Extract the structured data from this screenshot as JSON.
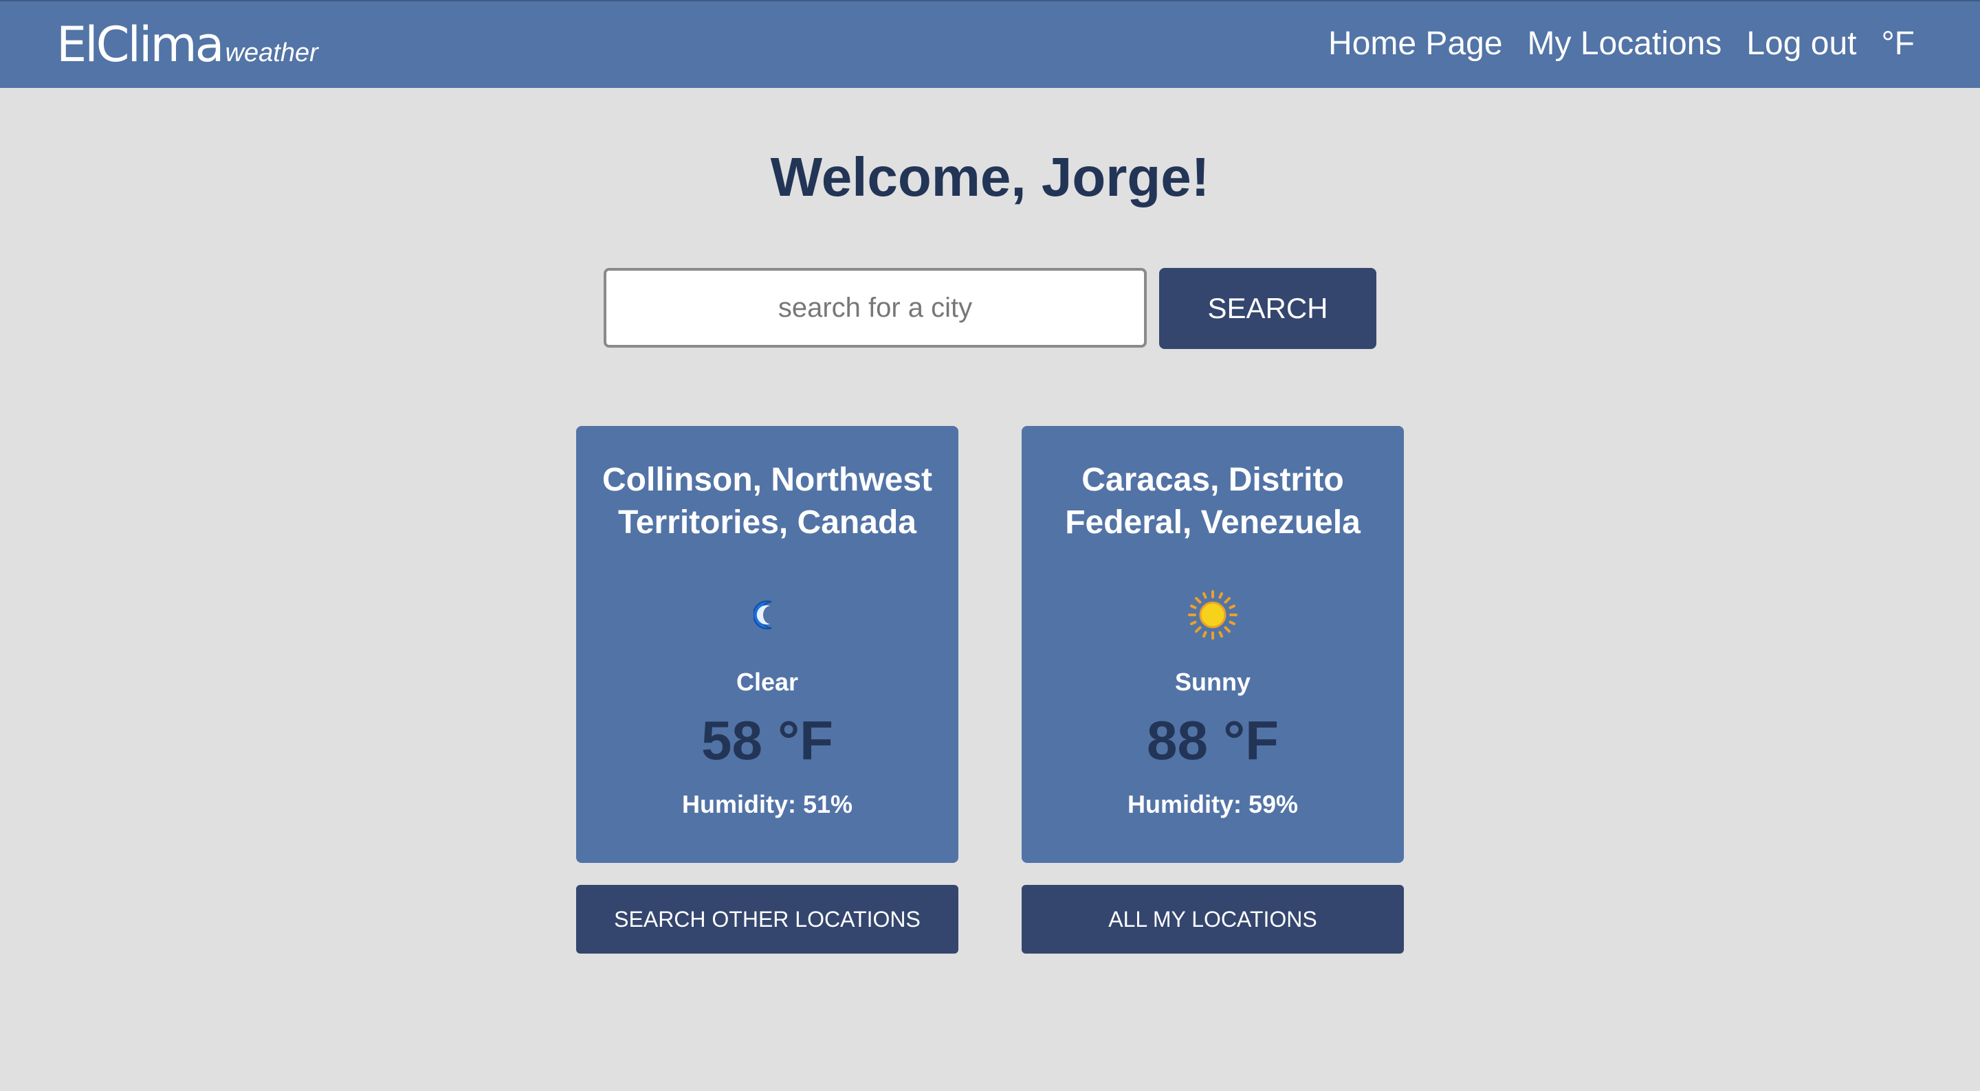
{
  "navbar": {
    "brand_main": "ElClima",
    "brand_sub": "weather",
    "links": {
      "home": "Home Page",
      "locations": "My Locations",
      "logout": "Log out",
      "unit": "°F"
    }
  },
  "welcome": "Welcome, Jorge!",
  "search": {
    "placeholder": "search for a city",
    "value": "",
    "button_label": "SEARCH"
  },
  "cards": [
    {
      "location": "Collinson, Northwest Territories, Canada",
      "icon": "crescent-moon-icon",
      "condition": "Clear",
      "temperature": "58 °F",
      "humidity": "Humidity: 51%"
    },
    {
      "location": "Caracas, Distrito Federal, Venezuela",
      "icon": "sun-icon",
      "condition": "Sunny",
      "temperature": "88 °F",
      "humidity": "Humidity: 59%"
    }
  ],
  "buttons": {
    "search_other": "SEARCH OTHER LOCATIONS",
    "all_locations": "ALL MY LOCATIONS"
  },
  "colors": {
    "navbar_bg": "#5274a6",
    "page_bg": "#e0e0e0",
    "card_bg": "#5273a6",
    "button_bg": "#34466e",
    "heading_text": "#233556"
  }
}
